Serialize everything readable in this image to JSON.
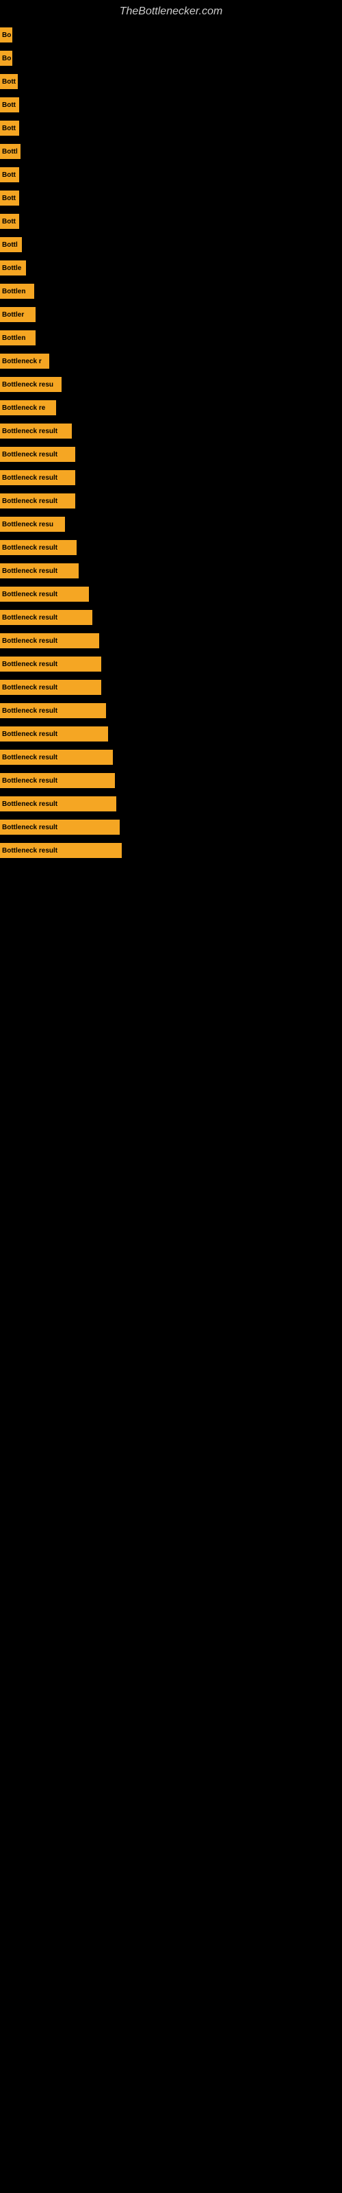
{
  "site": {
    "title": "TheBottlenecker.com"
  },
  "bars": [
    {
      "id": 1,
      "label": "Bo",
      "width": 18
    },
    {
      "id": 2,
      "label": "Bo",
      "width": 18
    },
    {
      "id": 3,
      "label": "Bott",
      "width": 26
    },
    {
      "id": 4,
      "label": "Bott",
      "width": 28
    },
    {
      "id": 5,
      "label": "Bott",
      "width": 28
    },
    {
      "id": 6,
      "label": "Bottl",
      "width": 30
    },
    {
      "id": 7,
      "label": "Bott",
      "width": 28
    },
    {
      "id": 8,
      "label": "Bott",
      "width": 28
    },
    {
      "id": 9,
      "label": "Bott",
      "width": 28
    },
    {
      "id": 10,
      "label": "Bottl",
      "width": 32
    },
    {
      "id": 11,
      "label": "Bottle",
      "width": 38
    },
    {
      "id": 12,
      "label": "Bottlen",
      "width": 50
    },
    {
      "id": 13,
      "label": "Bottler",
      "width": 52
    },
    {
      "id": 14,
      "label": "Bottlen",
      "width": 52
    },
    {
      "id": 15,
      "label": "Bottleneck r",
      "width": 72
    },
    {
      "id": 16,
      "label": "Bottleneck resu",
      "width": 90
    },
    {
      "id": 17,
      "label": "Bottleneck re",
      "width": 82
    },
    {
      "id": 18,
      "label": "Bottleneck result",
      "width": 105
    },
    {
      "id": 19,
      "label": "Bottleneck result",
      "width": 110
    },
    {
      "id": 20,
      "label": "Bottleneck result",
      "width": 110
    },
    {
      "id": 21,
      "label": "Bottleneck result",
      "width": 110
    },
    {
      "id": 22,
      "label": "Bottleneck resu",
      "width": 95
    },
    {
      "id": 23,
      "label": "Bottleneck result",
      "width": 112
    },
    {
      "id": 24,
      "label": "Bottleneck result",
      "width": 115
    },
    {
      "id": 25,
      "label": "Bottleneck result",
      "width": 130
    },
    {
      "id": 26,
      "label": "Bottleneck result",
      "width": 135
    },
    {
      "id": 27,
      "label": "Bottleneck result",
      "width": 145
    },
    {
      "id": 28,
      "label": "Bottleneck result",
      "width": 148
    },
    {
      "id": 29,
      "label": "Bottleneck result",
      "width": 148
    },
    {
      "id": 30,
      "label": "Bottleneck result",
      "width": 155
    },
    {
      "id": 31,
      "label": "Bottleneck result",
      "width": 158
    },
    {
      "id": 32,
      "label": "Bottleneck result",
      "width": 165
    },
    {
      "id": 33,
      "label": "Bottleneck result",
      "width": 168
    },
    {
      "id": 34,
      "label": "Bottleneck result",
      "width": 170
    },
    {
      "id": 35,
      "label": "Bottleneck result",
      "width": 175
    },
    {
      "id": 36,
      "label": "Bottleneck result",
      "width": 178
    }
  ]
}
